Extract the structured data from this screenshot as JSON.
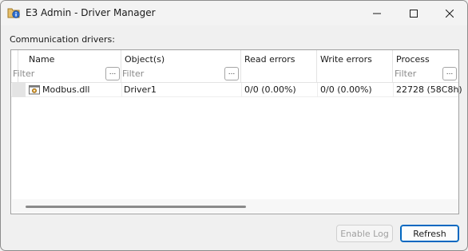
{
  "window": {
    "title": "E3 Admin - Driver Manager",
    "accent_color": "#0067c0"
  },
  "group": {
    "label": "Communication drivers:"
  },
  "grid": {
    "columns": [
      {
        "title": "Name",
        "filter_placeholder": "Filter",
        "has_filter_button": true
      },
      {
        "title": "Object(s)",
        "filter_placeholder": "Filter",
        "has_filter_button": true
      },
      {
        "title": "Read errors",
        "filter_placeholder": "",
        "has_filter_button": false
      },
      {
        "title": "Write errors",
        "filter_placeholder": "",
        "has_filter_button": false
      },
      {
        "title": "Process",
        "filter_placeholder": "Filter",
        "has_filter_button": true
      }
    ],
    "filter_button_label": "...",
    "rows": [
      {
        "icon": "dll-file-icon",
        "name": "Modbus.dll",
        "objects": "Driver1",
        "read_errors": "0/0 (0.00%)",
        "write_errors": "0/0 (0.00%)",
        "process": "22728 (58C8h)"
      }
    ]
  },
  "buttons": {
    "enable_log": "Enable Log",
    "refresh": "Refresh"
  }
}
